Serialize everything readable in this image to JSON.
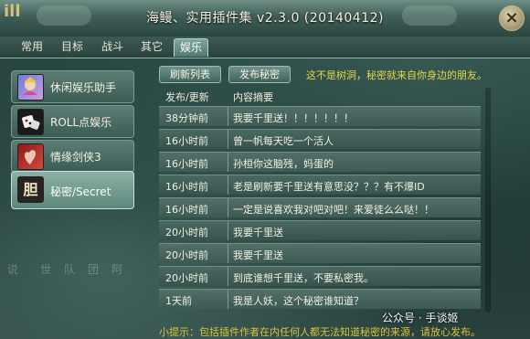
{
  "window": {
    "title": "海鳗、实用插件集 v2.3.0 (20140412)",
    "close_glyph": "×",
    "logo_glyph": "ill"
  },
  "tabs": [
    {
      "label": "常用"
    },
    {
      "label": "目标"
    },
    {
      "label": "战斗"
    },
    {
      "label": "其它"
    },
    {
      "label": "娱乐",
      "active": true
    }
  ],
  "sidebar": {
    "items": [
      {
        "label": "休闲娱乐助手",
        "icon": "jester-icon"
      },
      {
        "label": "ROLL点娱乐",
        "icon": "dice-icon"
      },
      {
        "label": "情缘剑侠3",
        "icon": "lovers-icon"
      },
      {
        "label": "秘密/Secret",
        "icon": "secret-character-icon",
        "icon_glyph": "胆",
        "active": true
      }
    ],
    "ghost_text": [
      "说",
      "世",
      "队",
      "团",
      "阿"
    ]
  },
  "toolbar": {
    "refresh_label": "刷新列表",
    "publish_label": "发布秘密",
    "notice": "这不是树洞，秘密就来自你身边的朋友。"
  },
  "table": {
    "headers": [
      "发布/更新",
      "内容摘要"
    ],
    "rows": [
      {
        "time": "38分钟前",
        "text": "我要千里送！！！！！！！"
      },
      {
        "time": "16小时前",
        "text": "曾一帆每天吃一个活人"
      },
      {
        "time": "16小时前",
        "text": "孙桓你这脑残，妈蛋的"
      },
      {
        "time": "16小时前",
        "text": "老是刷新要千里送有意思没？？？有不爆ID"
      },
      {
        "time": "16小时前",
        "text": "一定是说喜欢我对吧对吧！来爱徒么么哒！！"
      },
      {
        "time": "20小时前",
        "text": "我要千里送"
      },
      {
        "time": "20小时前",
        "text": "我要千里送"
      },
      {
        "time": "20小时前",
        "text": "到底谁想千里送，不要私密我。"
      },
      {
        "time": "1天前",
        "text": "我是人妖，这个秘密谁知道？"
      }
    ]
  },
  "footer_tip": "小提示：包括插件作者在内任何人都无法知道秘密的来源，请放心发布。",
  "watermark": "公众号 · 手谈姬",
  "colors": {
    "notice": "#e6d64a",
    "accent": "#5d877c"
  }
}
